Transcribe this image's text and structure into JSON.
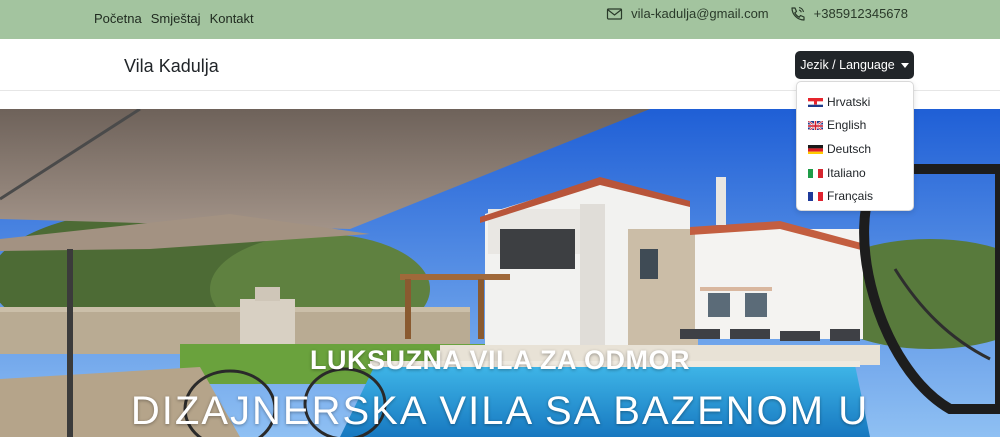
{
  "topbar": {
    "nav": [
      {
        "label": "Početna"
      },
      {
        "label": "Smještaj"
      },
      {
        "label": "Kontakt"
      }
    ],
    "email": "vila-kadulja@gmail.com",
    "phone": "+385912345678",
    "background": "#a3c49f"
  },
  "navbar": {
    "brand": "Vila Kadulja",
    "language_button": "Jezik / Language"
  },
  "language_menu": {
    "items": [
      {
        "label": "Hrvatski",
        "flag": "croatia-flag-icon"
      },
      {
        "label": "English",
        "flag": "uk-flag-icon"
      },
      {
        "label": "Deutsch",
        "flag": "germany-flag-icon"
      },
      {
        "label": "Italiano",
        "flag": "italy-flag-icon"
      },
      {
        "label": "Français",
        "flag": "france-flag-icon"
      }
    ]
  },
  "hero": {
    "subtitle": "LUKSUZNA VILA ZA ODMOR",
    "title": "DIZAJNERSKA VILA SA BAZENOM U"
  }
}
